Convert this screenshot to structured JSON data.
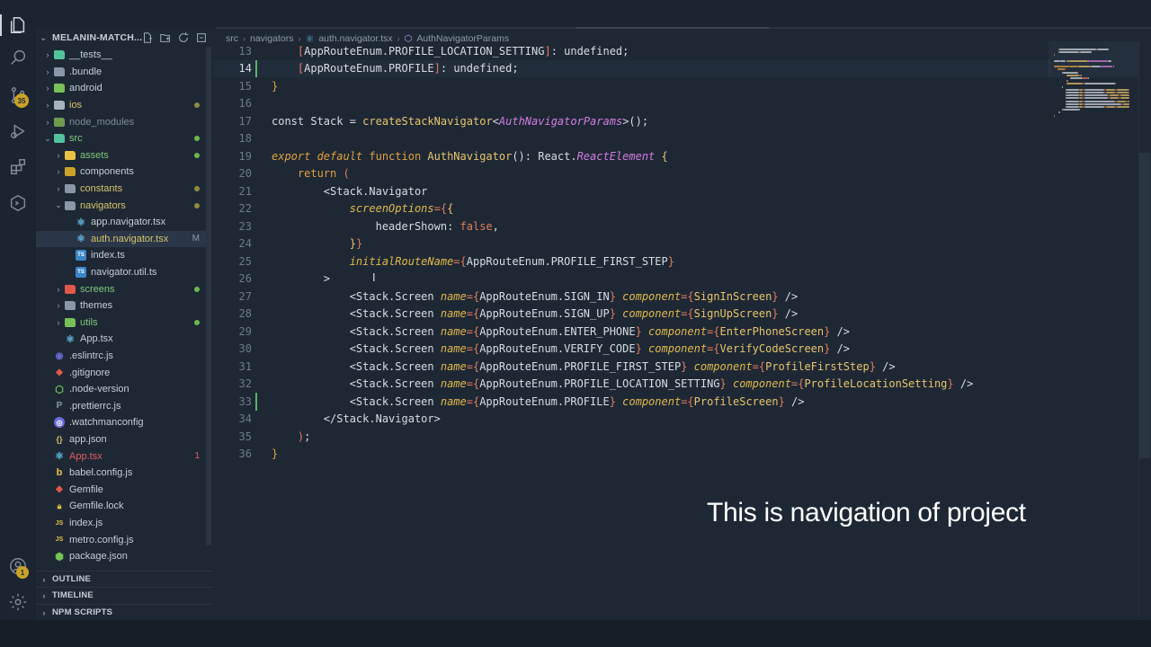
{
  "sidebar": {
    "title": "MELANIN-MATCH...",
    "panels": [
      "OUTLINE",
      "TIMELINE",
      "NPM SCRIPTS"
    ]
  },
  "activity": {
    "source_control_badge": "35",
    "accounts_badge": "1"
  },
  "tree": [
    {
      "label": "__tests__",
      "indent": 1,
      "kind": "folder",
      "arrow": "›",
      "color": "#c5ccd6",
      "icon_color": "#52c49d",
      "status": ""
    },
    {
      "label": ".bundle",
      "indent": 1,
      "kind": "folder",
      "arrow": "›",
      "color": "#c5ccd6",
      "icon_color": "#8a97a8",
      "status": ""
    },
    {
      "label": "android",
      "indent": 1,
      "kind": "folder",
      "arrow": "›",
      "color": "#c5ccd6",
      "icon_color": "#77c257",
      "status": ""
    },
    {
      "label": "ios",
      "indent": 1,
      "kind": "folder",
      "arrow": "›",
      "color": "#d6c36a",
      "icon_color": "#a8b3c2",
      "status": "dot-olive"
    },
    {
      "label": "node_modules",
      "indent": 1,
      "kind": "folder",
      "arrow": "›",
      "color": "#7e8a9a",
      "icon_color": "#6f9a50",
      "status": ""
    },
    {
      "label": "src",
      "indent": 1,
      "kind": "folder-open",
      "arrow": "⌄",
      "color": "#7ec77a",
      "icon_color": "#52c49d",
      "status": "dot-green"
    },
    {
      "label": "assets",
      "indent": 2,
      "kind": "folder",
      "arrow": "›",
      "color": "#7ec77a",
      "icon_color": "#e8c046",
      "status": "dot-green"
    },
    {
      "label": "components",
      "indent": 2,
      "kind": "folder",
      "arrow": "›",
      "color": "#c5ccd6",
      "icon_color": "#c9a227",
      "status": ""
    },
    {
      "label": "constants",
      "indent": 2,
      "kind": "folder",
      "arrow": "›",
      "color": "#d6c36a",
      "icon_color": "#8a97a8",
      "status": "dot-olive"
    },
    {
      "label": "navigators",
      "indent": 2,
      "kind": "folder-open",
      "arrow": "⌄",
      "color": "#d6c36a",
      "icon_color": "#8a97a8",
      "status": "dot-olive"
    },
    {
      "label": "app.navigator.tsx",
      "indent": 3,
      "kind": "react",
      "arrow": "",
      "color": "#c5ccd6",
      "icon_color": "#5fb8e0",
      "status": ""
    },
    {
      "label": "auth.navigator.tsx",
      "indent": 3,
      "kind": "react",
      "arrow": "",
      "color": "#d6c36a",
      "icon_color": "#5fb8e0",
      "status": "M",
      "selected": true
    },
    {
      "label": "index.ts",
      "indent": 3,
      "kind": "ts",
      "arrow": "",
      "color": "#c5ccd6",
      "icon_color": "#3a86c8",
      "status": ""
    },
    {
      "label": "navigator.util.ts",
      "indent": 3,
      "kind": "ts",
      "arrow": "",
      "color": "#c5ccd6",
      "icon_color": "#3a86c8",
      "status": ""
    },
    {
      "label": "screens",
      "indent": 2,
      "kind": "folder",
      "arrow": "›",
      "color": "#7ec77a",
      "icon_color": "#e0584a",
      "status": "dot-green"
    },
    {
      "label": "themes",
      "indent": 2,
      "kind": "folder",
      "arrow": "›",
      "color": "#c5ccd6",
      "icon_color": "#8a97a8",
      "status": ""
    },
    {
      "label": "utils",
      "indent": 2,
      "kind": "folder",
      "arrow": "›",
      "color": "#7ec77a",
      "icon_color": "#77c257",
      "status": "dot-green"
    },
    {
      "label": "App.tsx",
      "indent": 2,
      "kind": "react",
      "arrow": "",
      "color": "#c5ccd6",
      "icon_color": "#5fb8e0",
      "status": ""
    },
    {
      "label": ".eslintrc.js",
      "indent": 1,
      "kind": "circle",
      "arrow": "",
      "color": "#c5ccd6",
      "icon_color": "#6c6ad8",
      "status": ""
    },
    {
      "label": ".gitignore",
      "indent": 1,
      "kind": "diamond",
      "arrow": "",
      "color": "#c5ccd6",
      "icon_color": "#e0584a",
      "status": ""
    },
    {
      "label": ".node-version",
      "indent": 1,
      "kind": "hex",
      "arrow": "",
      "color": "#c5ccd6",
      "icon_color": "#77c257",
      "status": ""
    },
    {
      "label": ".prettierrc.js",
      "indent": 1,
      "kind": "p",
      "arrow": "",
      "color": "#c5ccd6",
      "icon_color": "#8a97a8",
      "status": ""
    },
    {
      "label": ".watchmanconfig",
      "indent": 1,
      "kind": "eye",
      "arrow": "",
      "color": "#c5ccd6",
      "icon_color": "#6c6ad8",
      "status": ""
    },
    {
      "label": "app.json",
      "indent": 1,
      "kind": "json",
      "arrow": "",
      "color": "#c5ccd6",
      "icon_color": "#d6c36a",
      "status": ""
    },
    {
      "label": "App.tsx",
      "indent": 1,
      "kind": "react",
      "arrow": "",
      "color": "#e25c62",
      "icon_color": "#5fb8e0",
      "status": "1"
    },
    {
      "label": "babel.config.js",
      "indent": 1,
      "kind": "babel",
      "arrow": "",
      "color": "#c5ccd6",
      "icon_color": "#e8c046",
      "status": ""
    },
    {
      "label": "Gemfile",
      "indent": 1,
      "kind": "ruby",
      "arrow": "",
      "color": "#c5ccd6",
      "icon_color": "#e0584a",
      "status": ""
    },
    {
      "label": "Gemfile.lock",
      "indent": 1,
      "kind": "lock",
      "arrow": "",
      "color": "#c5ccd6",
      "icon_color": "#e8c046",
      "status": ""
    },
    {
      "label": "index.js",
      "indent": 1,
      "kind": "js",
      "arrow": "",
      "color": "#c5ccd6",
      "icon_color": "#e8c046",
      "status": ""
    },
    {
      "label": "metro.config.js",
      "indent": 1,
      "kind": "js",
      "arrow": "",
      "color": "#c5ccd6",
      "icon_color": "#e8c046",
      "status": ""
    },
    {
      "label": "package.json",
      "indent": 1,
      "kind": "npm",
      "arrow": "",
      "color": "#c5ccd6",
      "icon_color": "#77c257",
      "status": ""
    }
  ],
  "breadcrumb": [
    "src",
    "navigators",
    "auth.navigator.tsx",
    "AuthNavigatorParams"
  ],
  "editor": {
    "current_line": 14,
    "lines": [
      {
        "n": "13",
        "tokens": [
          [
            "    ",
            "plain"
          ],
          [
            "[",
            "brace"
          ],
          [
            "AppRouteEnum.PROFILE_LOCATION_SETTING",
            "plain"
          ],
          [
            "]",
            "brace"
          ],
          [
            ": undefined;",
            "plain"
          ]
        ]
      },
      {
        "n": "14",
        "tokens": [
          [
            "    ",
            "plain"
          ],
          [
            "[",
            "brace"
          ],
          [
            "AppRouteEnum.PROFILE",
            "plain"
          ],
          [
            "]",
            "brace"
          ],
          [
            ": undefined;",
            "plain"
          ]
        ]
      },
      {
        "n": "15",
        "tokens": [
          [
            "}",
            "kw"
          ]
        ]
      },
      {
        "n": "16",
        "tokens": []
      },
      {
        "n": "17",
        "tokens": [
          [
            "const ",
            "plain"
          ],
          [
            "Stack",
            "plain"
          ],
          [
            " = ",
            "plain"
          ],
          [
            "createStackNavigator",
            "fn"
          ],
          [
            "<",
            "plain"
          ],
          [
            "AuthNavigatorParams",
            "type"
          ],
          [
            ">();",
            "plain"
          ]
        ]
      },
      {
        "n": "18",
        "tokens": []
      },
      {
        "n": "19",
        "tokens": [
          [
            "export default ",
            "kwi"
          ],
          [
            "function ",
            "kw"
          ],
          [
            "AuthNavigator",
            "fn"
          ],
          [
            "(): React.",
            "plain"
          ],
          [
            "ReactElement",
            "type"
          ],
          [
            " {",
            "fn"
          ]
        ]
      },
      {
        "n": "20",
        "tokens": [
          [
            "    return ",
            "kw"
          ],
          [
            "(",
            "brace"
          ]
        ]
      },
      {
        "n": "21",
        "tokens": [
          [
            "        <",
            "plain"
          ],
          [
            "Stack.Navigator",
            "plain"
          ]
        ]
      },
      {
        "n": "22",
        "tokens": [
          [
            "            ",
            "plain"
          ],
          [
            "screenOptions",
            "attr"
          ],
          [
            "={",
            "brace"
          ],
          [
            "{",
            "fn"
          ]
        ]
      },
      {
        "n": "23",
        "tokens": [
          [
            "                headerShown: ",
            "plain"
          ],
          [
            "false",
            "bool"
          ],
          [
            ",",
            "plain"
          ]
        ]
      },
      {
        "n": "24",
        "tokens": [
          [
            "            ",
            "plain"
          ],
          [
            "}",
            "fn"
          ],
          [
            "}",
            "brace"
          ]
        ]
      },
      {
        "n": "25",
        "tokens": [
          [
            "            ",
            "plain"
          ],
          [
            "initialRouteName",
            "attr"
          ],
          [
            "={",
            "brace"
          ],
          [
            "AppRouteEnum.PROFILE_FIRST_STEP",
            "plain"
          ],
          [
            "}",
            "brace"
          ]
        ]
      },
      {
        "n": "26",
        "tokens": [
          [
            "        >",
            "plain"
          ]
        ]
      },
      {
        "n": "27",
        "tokens": [
          [
            "            <",
            "plain"
          ],
          [
            "Stack.Screen ",
            "plain"
          ],
          [
            "name",
            "attr"
          ],
          [
            "={",
            "brace"
          ],
          [
            "AppRouteEnum.SIGN_IN",
            "plain"
          ],
          [
            "} ",
            "brace"
          ],
          [
            "component",
            "attr"
          ],
          [
            "={",
            "brace"
          ],
          [
            "SignInScreen",
            "fn"
          ],
          [
            "}",
            "brace"
          ],
          [
            " />",
            "plain"
          ]
        ]
      },
      {
        "n": "28",
        "tokens": [
          [
            "            <",
            "plain"
          ],
          [
            "Stack.Screen ",
            "plain"
          ],
          [
            "name",
            "attr"
          ],
          [
            "={",
            "brace"
          ],
          [
            "AppRouteEnum.SIGN_UP",
            "plain"
          ],
          [
            "} ",
            "brace"
          ],
          [
            "component",
            "attr"
          ],
          [
            "={",
            "brace"
          ],
          [
            "SignUpScreen",
            "fn"
          ],
          [
            "}",
            "brace"
          ],
          [
            " />",
            "plain"
          ]
        ]
      },
      {
        "n": "29",
        "tokens": [
          [
            "            <",
            "plain"
          ],
          [
            "Stack.Screen ",
            "plain"
          ],
          [
            "name",
            "attr"
          ],
          [
            "={",
            "brace"
          ],
          [
            "AppRouteEnum.ENTER_PHONE",
            "plain"
          ],
          [
            "} ",
            "brace"
          ],
          [
            "component",
            "attr"
          ],
          [
            "={",
            "brace"
          ],
          [
            "EnterPhoneScreen",
            "fn"
          ],
          [
            "}",
            "brace"
          ],
          [
            " />",
            "plain"
          ]
        ]
      },
      {
        "n": "30",
        "tokens": [
          [
            "            <",
            "plain"
          ],
          [
            "Stack.Screen ",
            "plain"
          ],
          [
            "name",
            "attr"
          ],
          [
            "={",
            "brace"
          ],
          [
            "AppRouteEnum.VERIFY_CODE",
            "plain"
          ],
          [
            "} ",
            "brace"
          ],
          [
            "component",
            "attr"
          ],
          [
            "={",
            "brace"
          ],
          [
            "VerifyCodeScreen",
            "fn"
          ],
          [
            "}",
            "brace"
          ],
          [
            " />",
            "plain"
          ]
        ]
      },
      {
        "n": "31",
        "tokens": [
          [
            "            <",
            "plain"
          ],
          [
            "Stack.Screen ",
            "plain"
          ],
          [
            "name",
            "attr"
          ],
          [
            "={",
            "brace"
          ],
          [
            "AppRouteEnum.PROFILE_FIRST_STEP",
            "plain"
          ],
          [
            "} ",
            "brace"
          ],
          [
            "component",
            "attr"
          ],
          [
            "={",
            "brace"
          ],
          [
            "ProfileFirstStep",
            "fn"
          ],
          [
            "}",
            "brace"
          ],
          [
            " />",
            "plain"
          ]
        ]
      },
      {
        "n": "32",
        "tokens": [
          [
            "            <",
            "plain"
          ],
          [
            "Stack.Screen ",
            "plain"
          ],
          [
            "name",
            "attr"
          ],
          [
            "={",
            "brace"
          ],
          [
            "AppRouteEnum.PROFILE_LOCATION_SETTING",
            "plain"
          ],
          [
            "} ",
            "brace"
          ],
          [
            "component",
            "attr"
          ],
          [
            "={",
            "brace"
          ],
          [
            "ProfileLocationSetting",
            "fn"
          ],
          [
            "}",
            "brace"
          ],
          [
            " />",
            "plain"
          ]
        ]
      },
      {
        "n": "33",
        "tokens": [
          [
            "            <",
            "plain"
          ],
          [
            "Stack.Screen ",
            "plain"
          ],
          [
            "name",
            "attr"
          ],
          [
            "={",
            "brace"
          ],
          [
            "AppRouteEnum.PROFILE",
            "plain"
          ],
          [
            "} ",
            "brace"
          ],
          [
            "component",
            "attr"
          ],
          [
            "={",
            "brace"
          ],
          [
            "ProfileScreen",
            "fn"
          ],
          [
            "}",
            "brace"
          ],
          [
            " />",
            "plain"
          ]
        ]
      },
      {
        "n": "34",
        "tokens": [
          [
            "        </",
            "plain"
          ],
          [
            "Stack.Navigator",
            "plain"
          ],
          [
            ">",
            "plain"
          ]
        ]
      },
      {
        "n": "35",
        "tokens": [
          [
            "    ",
            "plain"
          ],
          [
            ")",
            "brace"
          ],
          [
            ";",
            "plain"
          ]
        ]
      },
      {
        "n": "36",
        "tokens": [
          [
            "}",
            "kw"
          ]
        ]
      }
    ],
    "modified_lines": [
      "14",
      "33"
    ]
  },
  "caption": "This is navigation of project",
  "colors": {
    "background": "#1e2835",
    "keyword": "#e0a13c",
    "function": "#e8c46a",
    "type": "#d47ce0",
    "brace": "#e37b5a",
    "git_added": "#5ab36b"
  }
}
